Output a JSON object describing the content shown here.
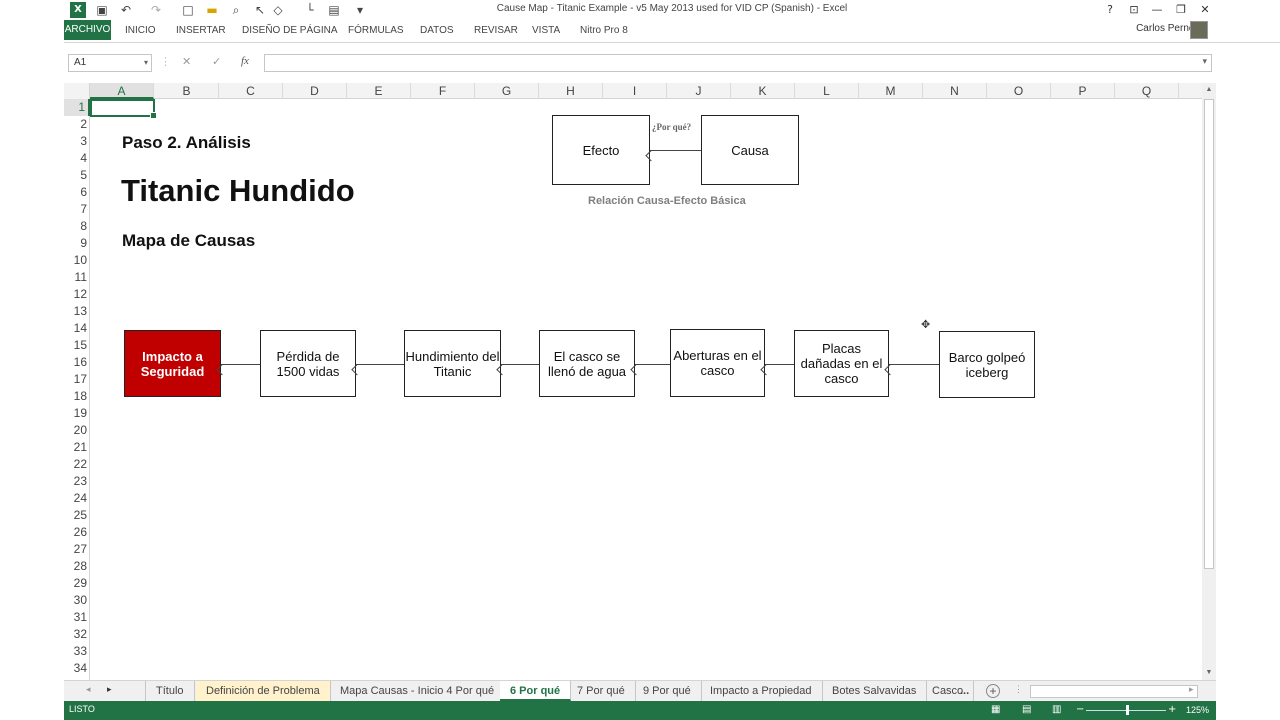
{
  "window": {
    "title": "Cause Map - Titanic Example - v5 May 2013 used for VID CP (Spanish) - Excel",
    "help": "?",
    "minimize": "—",
    "restore": "❐",
    "close": "✕"
  },
  "ribbon": {
    "tabs": [
      "ARCHIVO",
      "INICIO",
      "INSERTAR",
      "DISEÑO DE PÁGINA",
      "FÓRMULAS",
      "DATOS",
      "REVISAR",
      "VISTA",
      "Nitro Pro 8"
    ],
    "user": "Carlos Pernett"
  },
  "formula_bar": {
    "name_box": "A1",
    "cancel": "✕",
    "enter": "✓",
    "fx": "fx",
    "value": ""
  },
  "grid": {
    "columns": [
      "A",
      "B",
      "C",
      "D",
      "E",
      "F",
      "G",
      "H",
      "I",
      "J",
      "K",
      "L",
      "M",
      "N",
      "O",
      "P",
      "Q"
    ],
    "rows": [
      "1",
      "2",
      "3",
      "4",
      "5",
      "6",
      "7",
      "8",
      "9",
      "10",
      "11",
      "12",
      "13",
      "14",
      "15",
      "16",
      "17",
      "18",
      "19",
      "20",
      "21",
      "22",
      "23",
      "24",
      "25",
      "26",
      "27",
      "28",
      "29",
      "30",
      "31",
      "32",
      "33",
      "34"
    ],
    "selected_cell": "A1"
  },
  "sheet": {
    "step": "Paso 2. Análisis",
    "title": "Titanic Hundido",
    "subtitle": "Mapa de Causas",
    "legend": {
      "effect": "Efecto",
      "cause": "Causa",
      "question": "¿Por qué?",
      "caption": "Relación Causa-Efecto Básica"
    },
    "chain": [
      "Impacto a Seguridad",
      "Pérdida de 1500 vidas",
      "Hundimiento del Titanic",
      "El casco se llenó de agua",
      "Aberturas en el casco",
      "Placas dañadas en el casco",
      "Barco golpeó iceberg"
    ],
    "colors": {
      "impact": "#c00000",
      "accent": "#217346"
    }
  },
  "sheet_tabs": {
    "tabs": [
      "Título",
      "Definición de Problema",
      "Mapa Causas - Inicio 4 Por qué",
      "6 Por qué",
      "7 Por qué",
      "9 Por qué",
      "Impacto a Propiedad",
      "Botes Salvavidas",
      "Casco"
    ],
    "active": "6 Por qué",
    "more": "..."
  },
  "status": {
    "text": "LISTO",
    "zoom": "125%"
  }
}
